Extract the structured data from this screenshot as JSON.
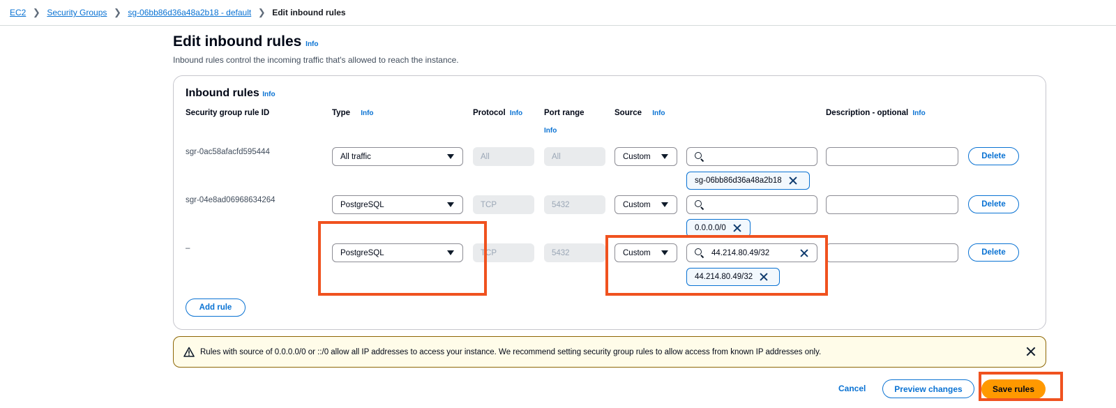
{
  "breadcrumb": {
    "items": [
      "EC2",
      "Security Groups",
      "sg-06bb86d36a48a2b18 - default"
    ],
    "current": "Edit inbound rules"
  },
  "header": {
    "title": "Edit inbound rules",
    "info": "Info",
    "description": "Inbound rules control the incoming traffic that's allowed to reach the instance."
  },
  "panel": {
    "title": "Inbound rules",
    "info": "Info",
    "columns": {
      "rule_id": "Security group rule ID",
      "type": "Type",
      "protocol": "Protocol",
      "port_range": "Port range",
      "source": "Source",
      "description": "Description - optional",
      "info": "Info"
    },
    "rows": [
      {
        "rule_id": "sgr-0ac58afacfd595444",
        "type": "All traffic",
        "protocol": "All",
        "port_range": "All",
        "source_type": "Custom",
        "source_search": "",
        "token": "sg-06bb86d36a48a2b18",
        "description": "",
        "delete": "Delete"
      },
      {
        "rule_id": "sgr-04e8ad06968634264",
        "type": "PostgreSQL",
        "protocol": "TCP",
        "port_range": "5432",
        "source_type": "Custom",
        "source_search": "",
        "token": "0.0.0.0/0",
        "description": "",
        "delete": "Delete"
      },
      {
        "rule_id": "–",
        "type": "PostgreSQL",
        "protocol": "TCP",
        "port_range": "5432",
        "source_type": "Custom",
        "source_search": "44.214.80.49/32",
        "token": "44.214.80.49/32",
        "description": "",
        "delete": "Delete"
      }
    ],
    "add_rule": "Add rule"
  },
  "alert": {
    "message": "Rules with source of 0.0.0.0/0 or ::/0 allow all IP addresses to access your instance. We recommend setting security group rules to allow access from known IP addresses only."
  },
  "footer": {
    "cancel": "Cancel",
    "preview": "Preview changes",
    "save": "Save rules"
  },
  "colors": {
    "link": "#0972d3",
    "primary": "#ff9900",
    "highlight": "#f0521f",
    "warning_bg": "#fffce9"
  }
}
